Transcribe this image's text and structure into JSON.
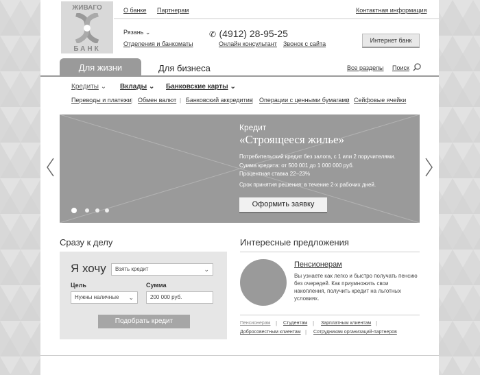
{
  "logo": {
    "top_text": "ЖИВАГО",
    "bottom_text": "БАНК"
  },
  "topnav": {
    "about": "О банке",
    "partners": "Партнерам",
    "contacts": "Контактная информация"
  },
  "header": {
    "city": "Рязань",
    "branches": "Отделения и банкоматы",
    "phone": "(4912) 28-95-25",
    "online_consultant": "Онлайн консультант",
    "callback": "Звонок с сайта",
    "internet_bank": "Интернет банк"
  },
  "tabs": {
    "personal": "Для жизни",
    "business": "Для бизнеса"
  },
  "utils": {
    "all_sections": "Все разделы",
    "search": "Поиск"
  },
  "menu_primary": {
    "credits": "Кредиты",
    "deposits": "Вклады",
    "cards": "Банковские карты"
  },
  "menu_secondary": {
    "transfers": "Переводы и платежи",
    "exchange": "Обмен валют",
    "letters_of_credit": "Банковский аккредитив",
    "securities": "Операции с ценными бумагами",
    "safes": "Сейфовые ячейки"
  },
  "banner": {
    "kicker": "Кредит",
    "title": "«Строящееся жилье»",
    "line1": "Потребительский кредит без залога, с 1 или 2 поручителями.",
    "line2": "Сумма кредита: от 500 001 до 1 000 000 руб.",
    "line3": "Процентная ставка 22–23%",
    "line4": "Срок принятия решения: в течение 2-х рабочих дней.",
    "cta": "Оформить заявку"
  },
  "quick": {
    "title": "Сразу к делу",
    "i_want": "Я хочу",
    "want_value": "Взять кредит",
    "goal_label": "Цель",
    "goal_value": "Нужны наличные",
    "amount_label": "Сумма",
    "amount_value": "200 000 руб.",
    "submit": "Подобрать кредит"
  },
  "offers": {
    "title": "Интересные предложения",
    "item_title": "Пенсионерам",
    "item_text": "Вы узнаете как легко и быстро получать пенсию без очередей. Как приумножить свои накопления, получить кредит на льготных условиях.",
    "links": {
      "pensioners": "Пенсионерам",
      "students": "Студентам",
      "salary": "Зарплатным клиентам",
      "honest": "Добросовестным клиентам",
      "partners_staff": "Сотрудникам организаций-партнеров"
    }
  },
  "colors": {
    "accent_gray": "#9a9a9a",
    "panel": "#e6e6e6",
    "background": "#dcdcdc"
  }
}
